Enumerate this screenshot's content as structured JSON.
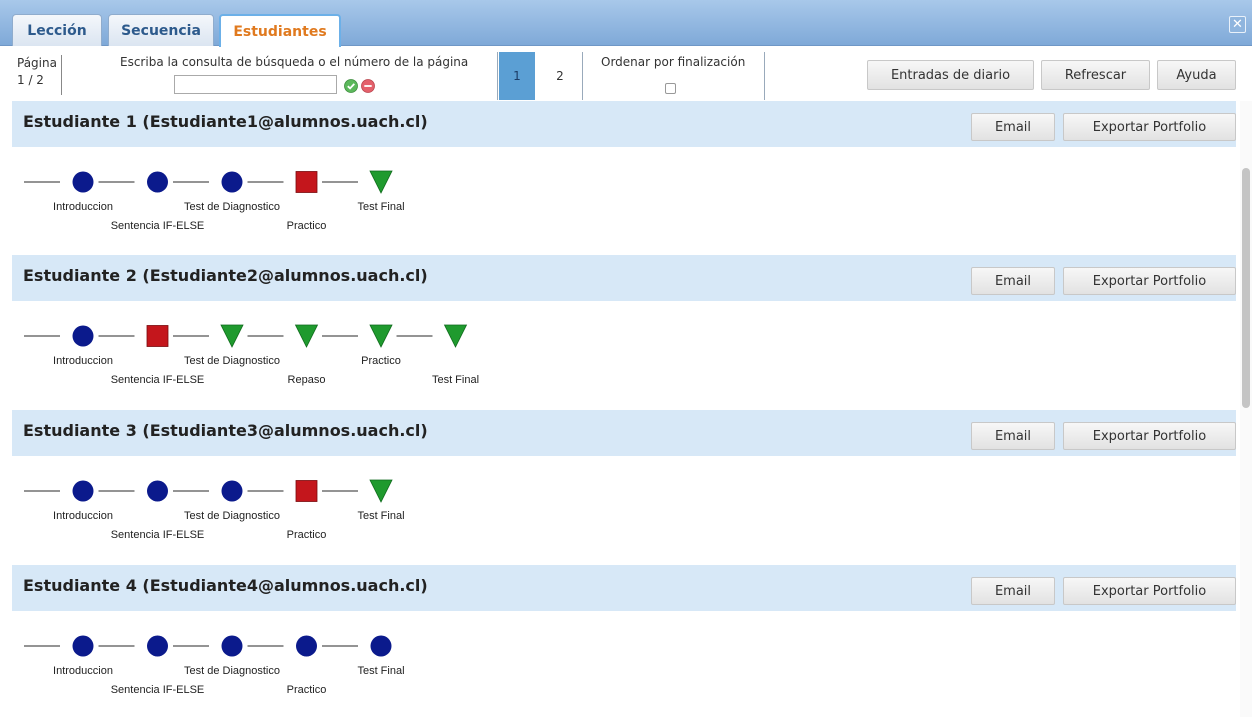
{
  "tabs": [
    {
      "label": "Lección",
      "active": false
    },
    {
      "label": "Secuencia",
      "active": false
    },
    {
      "label": "Estudiantes",
      "active": true
    }
  ],
  "close_icon": "close-icon",
  "toolbar": {
    "pagina_label": "Página",
    "pagina_value": "1 / 2",
    "search_label": "Escriba la consulta de búsqueda o el número de la página",
    "search_value": "",
    "pages": [
      "1",
      "2"
    ],
    "current_page": "1",
    "order_label": "Ordenar por finalización",
    "order_checked": false,
    "diario_label": "Entradas de diario",
    "refrescar_label": "Refrescar",
    "ayuda_label": "Ayuda"
  },
  "colors": {
    "done": "#0b1a8c",
    "failed": "#c4161c",
    "pending": "#1f9a2e",
    "header_bg": "#d7e8f7",
    "active_tab_text": "#e07a1f"
  },
  "status_icons": {
    "done": "circle-icon",
    "failed": "square-icon",
    "pending": "triangle-icon"
  },
  "students": [
    {
      "name": "Estudiante 1 (Estudiante1@alumnos.uach.cl)",
      "email_label": "Email",
      "export_label": "Exportar Portfolio",
      "steps": [
        {
          "label": "Introduccion",
          "status": "done"
        },
        {
          "label": "Sentencia IF-ELSE",
          "status": "done"
        },
        {
          "label": "Test de Diagnostico",
          "status": "done"
        },
        {
          "label": "Practico",
          "status": "failed"
        },
        {
          "label": "Test Final",
          "status": "pending"
        }
      ]
    },
    {
      "name": "Estudiante 2 (Estudiante2@alumnos.uach.cl)",
      "email_label": "Email",
      "export_label": "Exportar Portfolio",
      "steps": [
        {
          "label": "Introduccion",
          "status": "done"
        },
        {
          "label": "Sentencia IF-ELSE",
          "status": "failed"
        },
        {
          "label": "Test de Diagnostico",
          "status": "pending"
        },
        {
          "label": "Repaso",
          "status": "pending"
        },
        {
          "label": "Practico",
          "status": "pending"
        },
        {
          "label": "Test Final",
          "status": "pending"
        }
      ]
    },
    {
      "name": "Estudiante 3 (Estudiante3@alumnos.uach.cl)",
      "email_label": "Email",
      "export_label": "Exportar Portfolio",
      "steps": [
        {
          "label": "Introduccion",
          "status": "done"
        },
        {
          "label": "Sentencia IF-ELSE",
          "status": "done"
        },
        {
          "label": "Test de Diagnostico",
          "status": "done"
        },
        {
          "label": "Practico",
          "status": "failed"
        },
        {
          "label": "Test Final",
          "status": "pending"
        }
      ]
    },
    {
      "name": "Estudiante 4 (Estudiante4@alumnos.uach.cl)",
      "email_label": "Email",
      "export_label": "Exportar Portfolio",
      "steps": [
        {
          "label": "Introduccion",
          "status": "done"
        },
        {
          "label": "Sentencia IF-ELSE",
          "status": "done"
        },
        {
          "label": "Test de Diagnostico",
          "status": "done"
        },
        {
          "label": "Practico",
          "status": "done"
        },
        {
          "label": "Test Final",
          "status": "done"
        }
      ]
    }
  ]
}
